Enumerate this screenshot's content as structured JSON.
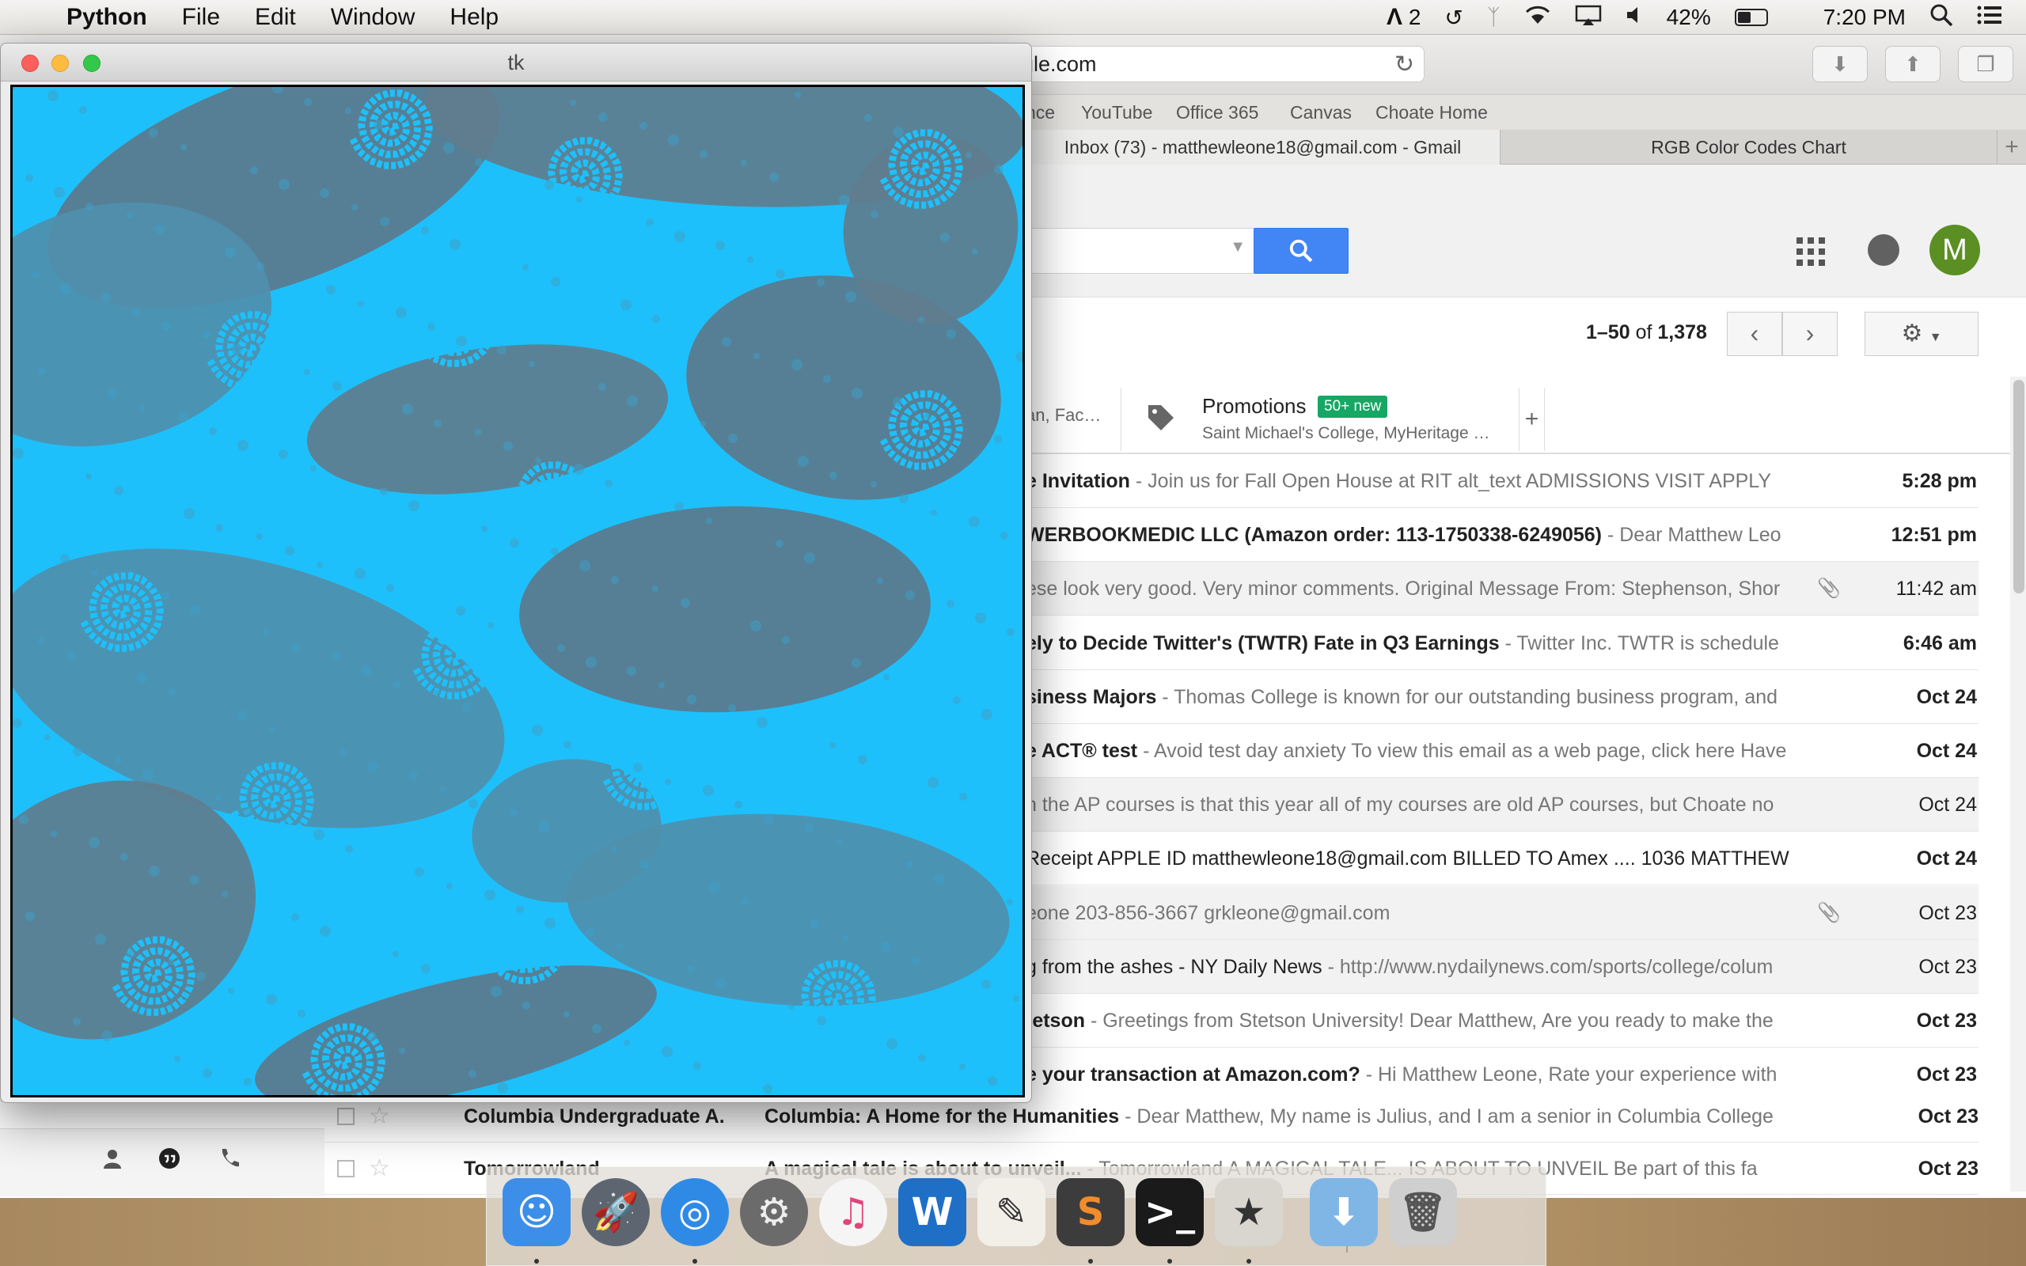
{
  "menubar": {
    "app_name": "Python",
    "menus": [
      "File",
      "Edit",
      "Window",
      "Help"
    ],
    "adobe_badge": "2",
    "battery_percent": "42%",
    "battery_level": 0.42,
    "clock": "7:20 PM"
  },
  "browser": {
    "url": "gle.com",
    "favorites": [
      "nce",
      "YouTube",
      "Office 365",
      "Canvas",
      "Choate Home"
    ],
    "tabs": [
      "Inbox (73) - matthewleone18@gmail.com - Gmail",
      "RGB Color Codes Chart"
    ],
    "new_tab": "+"
  },
  "gmail": {
    "avatar_letter": "M",
    "count_range": "1–50",
    "count_of": "of",
    "count_total": "1,378",
    "category_prev": "an, Fac…",
    "promotions": {
      "label": "Promotions",
      "badge": "50+ new",
      "snippet": "Saint Michael's College, MyHeritage …"
    },
    "add_category": "+",
    "rows": [
      {
        "subject": "e Invitation",
        "snippet": " - Join us for Fall Open House at RIT alt_text ADMISSIONS VISIT APPLY",
        "time": "5:28 pm",
        "unread": true,
        "attach": false
      },
      {
        "subject": "WERBOOKMEDIC LLC (Amazon order: 113-1750338-6249056)",
        "snippet": " - Dear Matthew Leo",
        "time": "12:51 pm",
        "unread": true,
        "attach": false
      },
      {
        "subject": "",
        "snippet": "ese look very good. Very minor comments. Original Message From: Stephenson, Shor",
        "time": "11:42 am",
        "unread": false,
        "attach": true
      },
      {
        "subject": "ely to Decide Twitter's (TWTR) Fate in Q3 Earnings",
        "snippet": " - Twitter Inc. TWTR is schedule",
        "time": "6:46 am",
        "unread": true,
        "attach": false
      },
      {
        "subject": "siness Majors",
        "snippet": " - Thomas College is known for our outstanding business program, and",
        "time": "Oct 24",
        "unread": true,
        "attach": false
      },
      {
        "subject": "e ACT® test",
        "snippet": " - Avoid test day anxiety To view this email as a web page, click here Have",
        "time": "Oct 24",
        "unread": true,
        "attach": false
      },
      {
        "subject": "",
        "snippet": "h the AP courses is that this year all of my courses are old AP courses, but Choate no",
        "time": "Oct 24",
        "unread": false,
        "attach": false
      },
      {
        "subject": "",
        "snippet": "Receipt APPLE ID matthewleone18@gmail.com BILLED TO Amex .... 1036 MATTHEW",
        "time": "Oct 24",
        "unread": true,
        "attach": false
      },
      {
        "subject": "",
        "snippet": "eone 203-856-3667 grkleone@gmail.com",
        "time": "Oct 23",
        "unread": false,
        "attach": true
      },
      {
        "subject": "g from the ashes - NY Daily News",
        "snippet": " - http://www.nydailynews.com/sports/college/colum",
        "time": "Oct 23",
        "unread": false,
        "attach": false
      },
      {
        "subject": "tetson",
        "snippet": " - Greetings from Stetson University! Dear Matthew, Are you ready to make the",
        "time": "Oct 23",
        "unread": true,
        "attach": false
      },
      {
        "subject": "e your transaction at Amazon.com?",
        "snippet": " - Hi Matthew Leone, Rate your experience with",
        "time": "Oct 23",
        "unread": true,
        "attach": false
      }
    ],
    "lower_rows": [
      {
        "sender": "Columbia Undergraduate A.",
        "subject": "Columbia: A Home for the Humanities",
        "snippet": " - Dear Matthew, My name is Julius, and I am a senior in Columbia College",
        "time": "Oct 23"
      },
      {
        "sender": "Tomorrowland",
        "subject": "A magical tale is about to unveil...",
        "snippet": " - Tomorrowland A MAGICAL TALE... IS ABOUT TO UNVEIL Be part of this fa",
        "time": "Oct 23"
      }
    ]
  },
  "tk_window": {
    "title": "tk",
    "fractal_colors": {
      "fill": "#1ec0fb",
      "background": "#5b7a8c",
      "mid": "#3f9fc6"
    }
  },
  "dock": {
    "items": [
      "Finder",
      "Launchpad",
      "Safari",
      "System Preferences",
      "iTunes",
      "Word",
      "Pages",
      "Sublime Text",
      "Terminal",
      "Python Launcher",
      "Downloads",
      "Trash"
    ]
  }
}
